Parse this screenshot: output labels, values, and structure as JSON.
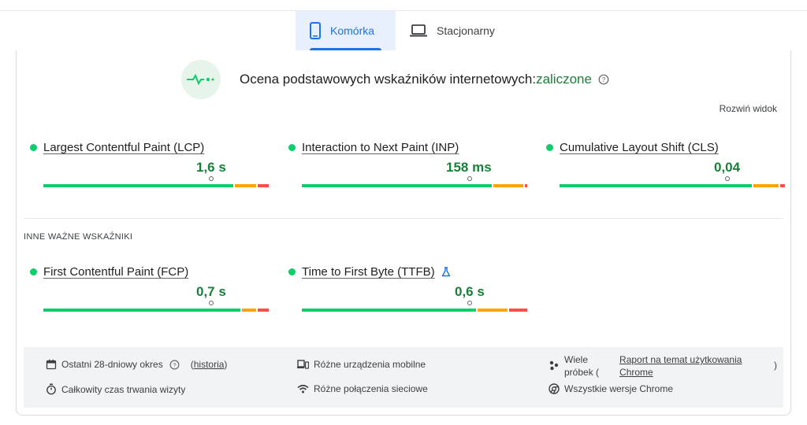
{
  "tabs": [
    {
      "label": "Komórka",
      "icon": "phone-icon",
      "active": true
    },
    {
      "label": "Stacjonarny",
      "icon": "laptop-icon",
      "active": false
    }
  ],
  "assessment": {
    "label": "Ocena podstawowych wskaźników internetowych:",
    "status": "zaliczone",
    "status_color": "#188038"
  },
  "expand_label": "Rozwiń widok",
  "core_metrics": [
    {
      "name": "Largest Contentful Paint (LCP)",
      "value": "1,6 s",
      "marker_pct": 74.5,
      "good_pct": 85,
      "ni_pct": 10,
      "poor_pct": 5
    },
    {
      "name": "Interaction to Next Paint (INP)",
      "value": "158 ms",
      "marker_pct": 74.5,
      "good_pct": 85,
      "ni_pct": 14,
      "poor_pct": 1
    },
    {
      "name": "Cumulative Layout Shift (CLS)",
      "value": "0,04",
      "marker_pct": 74.5,
      "good_pct": 86,
      "ni_pct": 12,
      "poor_pct": 2
    }
  ],
  "other_label": "INNE WAŻNE WSKAŹNIKI",
  "other_metrics": [
    {
      "name": "First Contentful Paint (FCP)",
      "value": "0,7 s",
      "marker_pct": 74.5,
      "good_pct": 88,
      "ni_pct": 7,
      "poor_pct": 5,
      "experimental": false
    },
    {
      "name": "Time to First Byte (TTFB)",
      "value": "0,6 s",
      "marker_pct": 74.5,
      "good_pct": 78,
      "ni_pct": 14,
      "poor_pct": 8,
      "experimental": true
    }
  ],
  "footer": {
    "period_label": "Ostatni 28-dniowy okres",
    "history_open": "(",
    "history_link": "historia",
    "history_close": ")",
    "duration_label": "Całkowity czas trwania wizyty",
    "devices_label": "Różne urządzenia mobilne",
    "connections_label": "Różne połączenia sieciowe",
    "samples_prefix_1": "Wiele",
    "samples_prefix_2": "próbek (",
    "samples_link": "Raport na temat użytkowania Chrome",
    "samples_suffix": ")",
    "chrome_label": "Wszystkie wersje Chrome"
  },
  "colors": {
    "good": "#0cce6b",
    "needs_improvement": "#ffa400",
    "poor": "#ff4e42",
    "accent": "#1a73e8"
  }
}
